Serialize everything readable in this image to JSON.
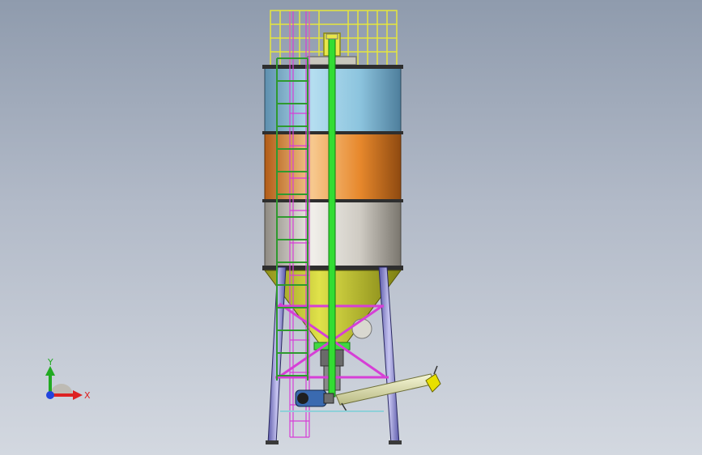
{
  "viewport": {
    "background_top": "#8f9bad",
    "background_bottom": "#d3d8e0"
  },
  "model": {
    "colors": {
      "band_top": "#9fd0e6",
      "band_middle": "#e8923a",
      "band_bottom": "#d2cfc8",
      "cone": "#c9cc22",
      "railing": "#e6e63c",
      "ladder": "#3da33d",
      "cage": "#d63fd6",
      "pipe": "#33dd33",
      "legs": "#8a88d6",
      "bracing": "#d63fd6",
      "screw_conveyor": "#e3e4b0",
      "motor": "#3a6ab0"
    }
  },
  "triad": {
    "y_label": "Y",
    "x_label": "X",
    "y_color": "#22aa22",
    "x_color": "#dd2222",
    "z_color": "#2244dd"
  }
}
